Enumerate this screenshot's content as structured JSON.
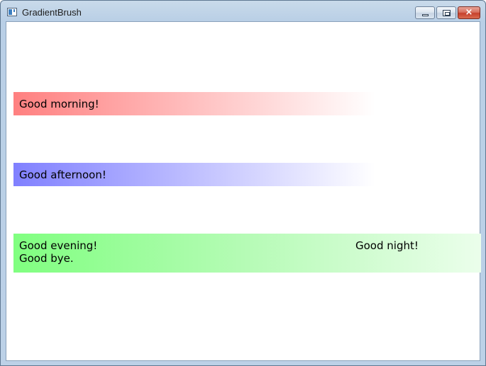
{
  "window": {
    "title": "GradientBrush",
    "controls": {
      "minimize": "minimize",
      "maximize": "maximize",
      "close": "×"
    }
  },
  "content": {
    "bands": [
      {
        "text": "Good morning!",
        "color": "#ff8080"
      },
      {
        "text": "Good afternoon!",
        "color": "#8080ff"
      },
      {
        "text_left_1": "Good evening!",
        "text_left_2": "Good bye.",
        "text_right": "Good night!",
        "color": "#80ff80"
      }
    ]
  }
}
